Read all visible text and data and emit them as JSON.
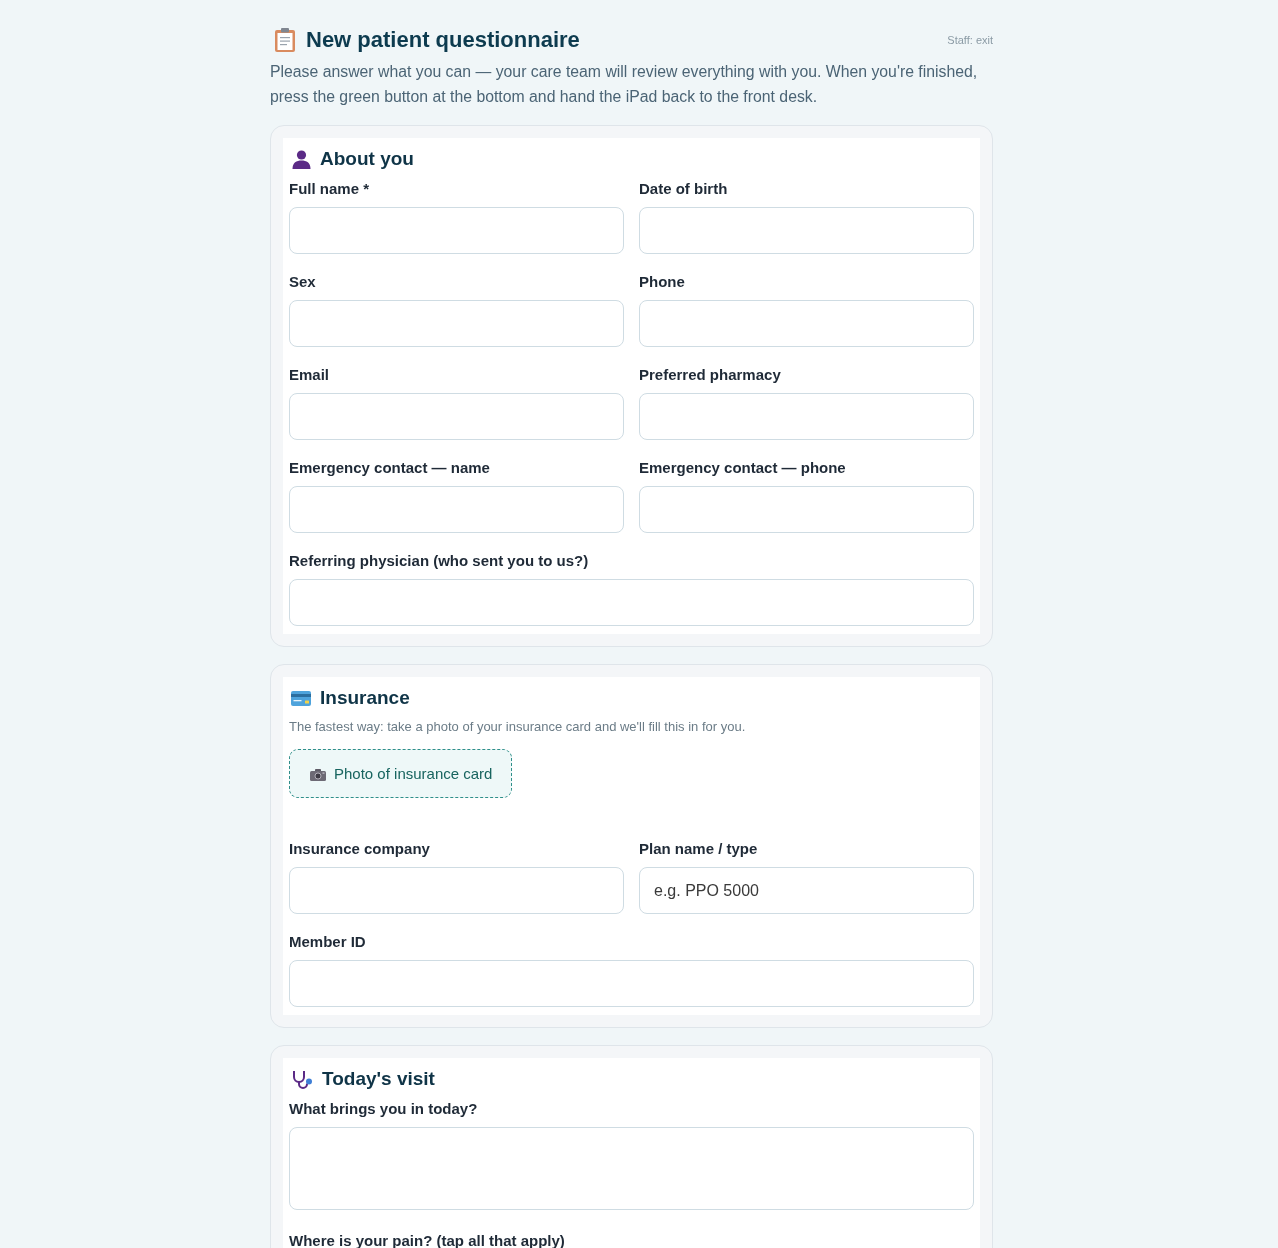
{
  "header": {
    "title": "New patient questionnaire",
    "staff_link": "Staff: exit",
    "intro": "Please answer what you can — your care team will review everything with you. When you're finished, press the green button at the bottom and hand the iPad back to the front desk."
  },
  "sections": [
    {
      "title": "About you",
      "fields": [
        {
          "label": "Full name *",
          "kind": "input"
        },
        {
          "label": "Date of birth",
          "kind": "input"
        },
        {
          "label": "Sex",
          "kind": "input"
        },
        {
          "label": "Phone",
          "kind": "input"
        },
        {
          "label": "Email",
          "kind": "input"
        },
        {
          "label": "Preferred pharmacy",
          "kind": "input"
        },
        {
          "label": "Emergency contact — name",
          "kind": "input"
        },
        {
          "label": "Emergency contact — phone",
          "kind": "input"
        },
        {
          "label": "Referring physician (who sent you to us?)",
          "kind": "input"
        }
      ]
    },
    {
      "title": "Insurance",
      "note": "The fastest way: take a photo of your insurance card and we'll fill this in for you.",
      "action": {
        "label": "Photo of insurance card"
      },
      "fields": [
        {
          "label": "Insurance company",
          "kind": "input"
        },
        {
          "label": "Plan name / type",
          "kind": "input",
          "placeholder": "e.g. PPO 5000"
        },
        {
          "label": "Member ID",
          "kind": "input"
        }
      ]
    },
    {
      "title": "Today's visit",
      "fields": [
        {
          "label": "What brings you in today?",
          "kind": "textarea"
        },
        {
          "label": "Where is your pain? (tap all that apply)",
          "kind": "checklist"
        }
      ]
    }
  ]
}
